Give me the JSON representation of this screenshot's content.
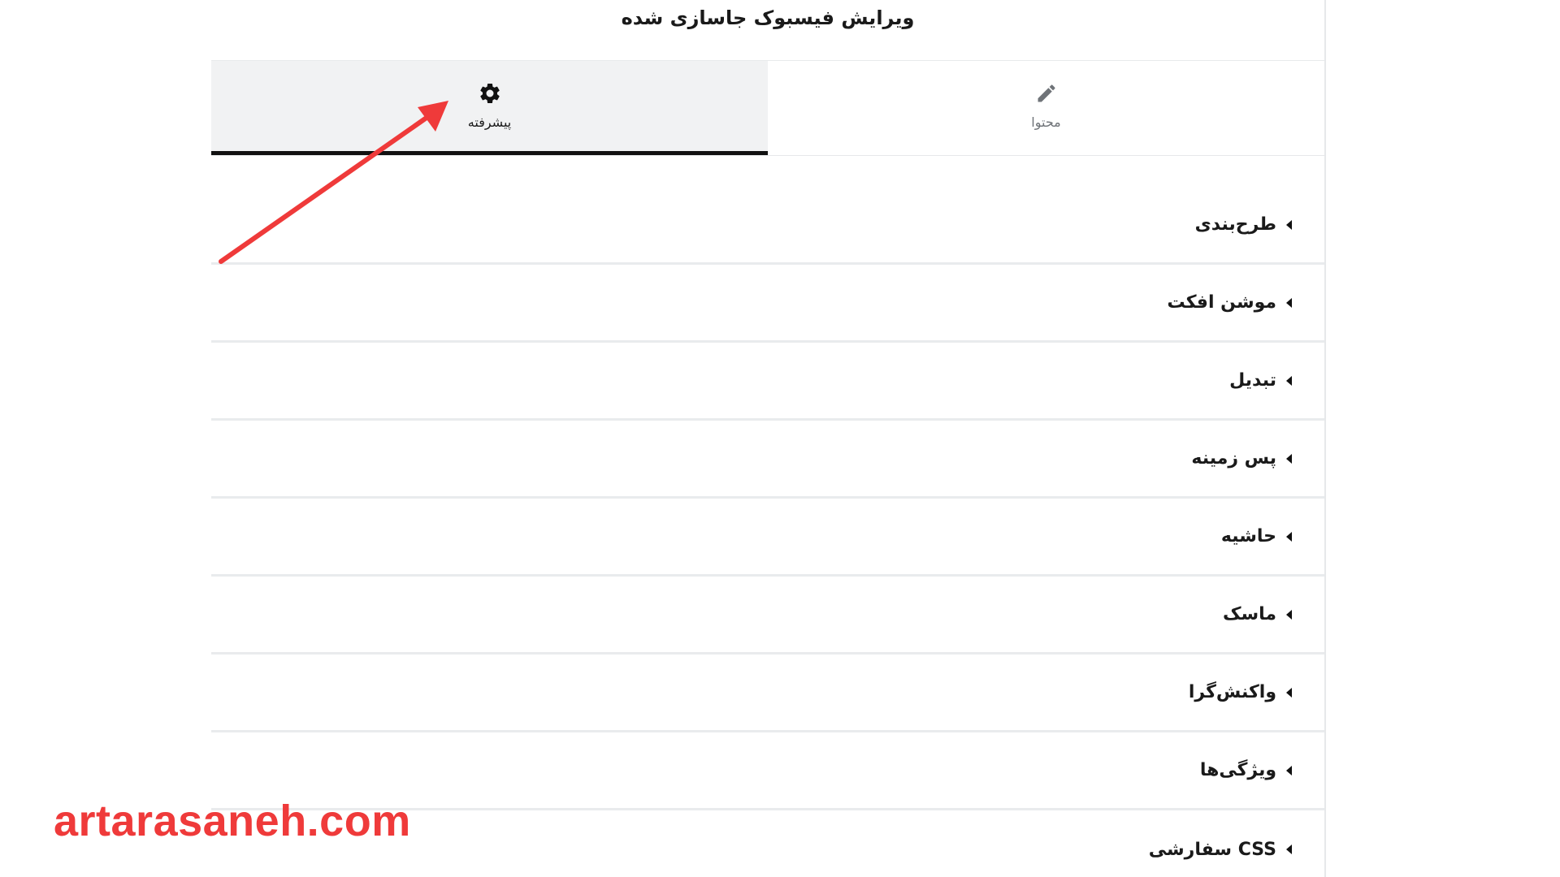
{
  "panel": {
    "title": "ویرایش فیسبوک جاسازی شده"
  },
  "tabs": [
    {
      "label": "محتوا",
      "icon": "pencil-icon",
      "active": false
    },
    {
      "label": "پیشرفته",
      "icon": "gear-icon",
      "active": true
    }
  ],
  "sections": [
    {
      "label": "طرح‌بندی"
    },
    {
      "label": "موشن افکت"
    },
    {
      "label": "تبدیل"
    },
    {
      "label": "پس زمینه"
    },
    {
      "label": "حاشیه"
    },
    {
      "label": "ماسک"
    },
    {
      "label": "واکنش‌گرا"
    },
    {
      "label": "ویژگی‌ها"
    },
    {
      "label": "CSS سفارشی"
    }
  ],
  "watermark": {
    "text": "artarasaneh.com",
    "color": "#ef3a3a"
  },
  "colors": {
    "annotation_arrow": "#ef3a3a",
    "active_tab_bg": "#f1f2f3",
    "active_tab_underline": "#111111"
  }
}
